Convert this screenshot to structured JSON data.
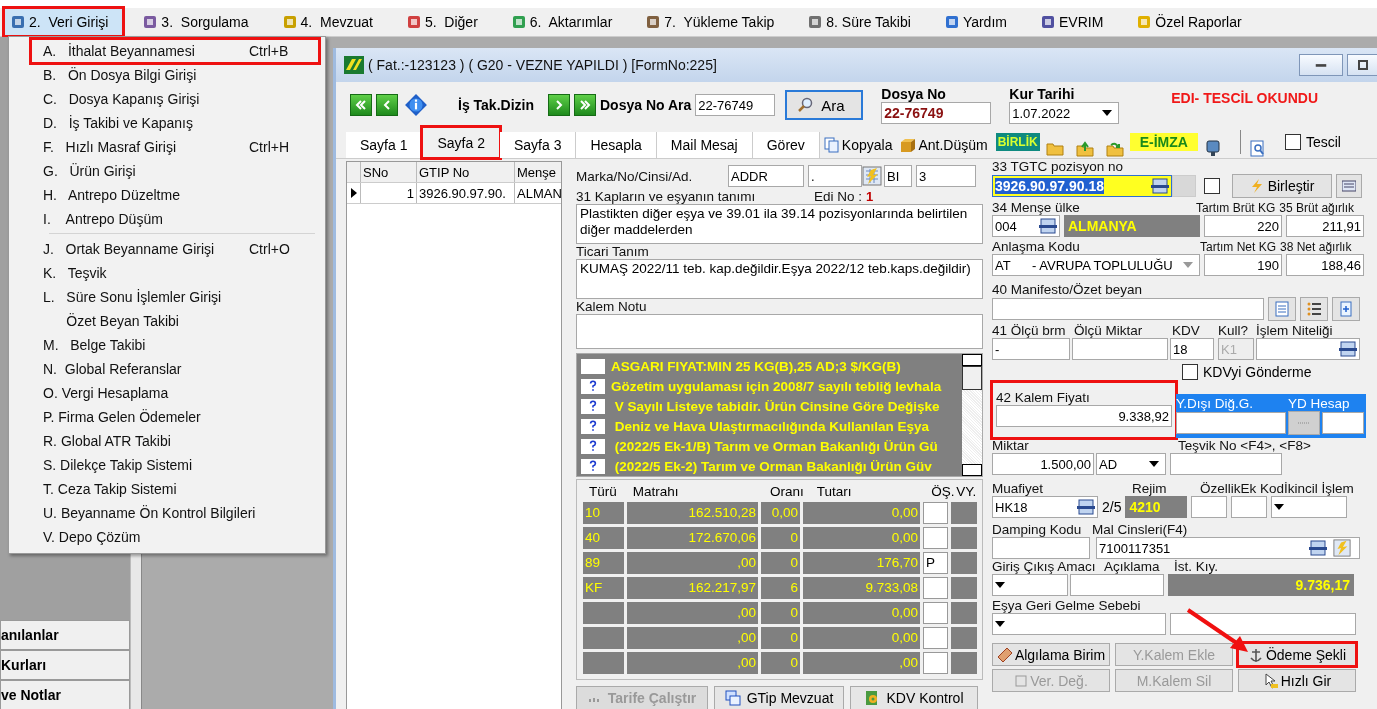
{
  "menu_bar": [
    {
      "label": "2.  Veri Girişi",
      "selected": true,
      "marked": true
    },
    {
      "label": "3.  Sorgulama",
      "selected": false,
      "marked": false
    },
    {
      "label": "4.  Mevzuat",
      "selected": false,
      "marked": false
    },
    {
      "label": "5.  Diğer",
      "selected": false,
      "marked": false
    },
    {
      "label": "6.  Aktarımlar",
      "selected": false,
      "marked": false
    },
    {
      "label": "7.  Yükleme Takip",
      "selected": false,
      "marked": false
    },
    {
      "label": "8. Süre Takibi",
      "selected": false,
      "marked": false
    },
    {
      "label": "Yardım",
      "selected": false,
      "marked": false
    },
    {
      "label": "EVRIM",
      "selected": false,
      "marked": false
    },
    {
      "label": "Özel Raporlar",
      "selected": false,
      "marked": false
    }
  ],
  "dropdown": {
    "groups": [
      [
        {
          "label": "A.   İthalat Beyannamesi",
          "shortcut": "Ctrl+B",
          "marked": true
        },
        {
          "label": "B.   Ön Dosya Bilgi Girişi",
          "marked": false
        },
        {
          "label": "C.   Dosya Kapanış Girişi",
          "marked": false
        },
        {
          "label": "D.   İş Takibi ve Kapanış",
          "marked": false
        },
        {
          "label": "F.   Hızlı Masraf Girişi",
          "shortcut": "Ctrl+H",
          "marked": false
        },
        {
          "label": "G.   Ürün Girişi",
          "marked": false
        },
        {
          "label": "H.   Antrepo Düzeltme",
          "marked": false
        },
        {
          "label": "I.    Antrepo Düşüm",
          "marked": false
        }
      ],
      [
        {
          "label": "J.   Ortak Beyanname Girişi",
          "shortcut": "Ctrl+O",
          "marked": false
        },
        {
          "label": "K.   Teşvik",
          "marked": false
        },
        {
          "label": "L.   Süre Sonu İşlemler Girişi",
          "marked": false
        },
        {
          "label": "      Özet Beyan Takibi",
          "marked": false
        },
        {
          "label": "M.   Belge Takibi",
          "marked": false
        },
        {
          "label": "N.  Global Referanslar",
          "marked": false
        },
        {
          "label": "O. Vergi Hesaplama",
          "marked": false
        },
        {
          "label": "P. Firma Gelen Ödemeler",
          "marked": false
        },
        {
          "label": "R. Global ATR Takibi",
          "marked": false
        },
        {
          "label": "S. Dilekçe Takip Sistemi",
          "marked": false
        },
        {
          "label": "T. Ceza Takip Sistemi",
          "marked": false
        },
        {
          "label": "U. Beyanname Ön Kontrol Bilgileri",
          "marked": false
        },
        {
          "label": "V. Depo Çözüm",
          "marked": false
        }
      ]
    ]
  },
  "sidebar": {
    "buttons": [
      "anılanlar",
      "Kurları",
      "ve Notlar"
    ]
  },
  "window": {
    "title": "( Fat.:-123123 ) ( G20 - VEZNE YAPILDI ) [FormNo:225]",
    "toolbar": {
      "dizin_label": "İş Tak.Dizin",
      "search_label": "Dosya No Ara",
      "search_value": "22-76749",
      "search_button": "Ara",
      "dosya_label": "Dosya No",
      "dosya_value": "22-76749",
      "kur_label": "Kur Tarihi",
      "kur_value": "1.07.2022",
      "status": "EDI- TESCİL OKUNDU"
    },
    "tabs": [
      {
        "label": "Sayfa 1",
        "selected": false,
        "marked": false
      },
      {
        "label": "Sayfa 2",
        "selected": true,
        "marked": true
      },
      {
        "label": "Sayfa 3",
        "selected": false,
        "marked": false
      },
      {
        "label": "Hesapla",
        "selected": false,
        "marked": false
      },
      {
        "label": "Mail Mesaj",
        "selected": false,
        "marked": false
      },
      {
        "label": "Görev",
        "selected": false,
        "marked": false
      }
    ],
    "actions": {
      "copy": "Kopyala",
      "ant": "Ant.Düşüm",
      "birlik": "BİRLİK",
      "eimza": "E-İMZA",
      "tescil": "Tescil",
      "tescil_checked": false
    },
    "grid": {
      "columns": [
        "SNo",
        "GTIP No",
        "Menşe"
      ],
      "rows": [
        [
          "1",
          "3926.90.97.90.",
          "ALMAN"
        ]
      ]
    },
    "middle": {
      "marka_label": "Marka/No/Cinsi/Ad.",
      "marka": [
        "ADDR",
        ".",
        "BI",
        "3"
      ],
      "tanim_label": "31 Kapların ve eşyanın tanımı",
      "edi_label": "Edi No :",
      "edi_value": "1",
      "tanim": "Plastikten diğer eşya ve 39.01 ila 39.14 pozisyonlarında belirtilen diğer maddelerden",
      "ticari_label": "Ticari Tanım",
      "ticari": "KUMAŞ 2022/11 teb. kap.değildir.Eşya 2022/12 teb.kaps.değildir)",
      "not_label": "Kalem Notu",
      "warnings": [
        {
          "text": "ASGARI FIYAT:MIN 25 KG(B),25 AD;3 $/KG(B)",
          "help": false
        },
        {
          "text": "Gözetim uygulaması için 2008/7 sayılı tebliğ levhala",
          "help": true
        },
        {
          "text": " V Sayılı Listeye tabidir. Ürün Cinsine Göre Değişke",
          "help": true
        },
        {
          "text": " Deniz ve Hava Ulaştırmacılığında Kullanılan Eşya",
          "help": true
        },
        {
          "text": " (2022/5 Ek-1/B) Tarım ve Orman Bakanlığı Ürün Gü",
          "help": true
        },
        {
          "text": " (2022/5 Ek-2) Tarım ve Orman Bakanlığı Ürün Güv",
          "help": true
        }
      ],
      "tax_columns": [
        "Türü",
        "Matrahı",
        "Oranı",
        "Tutarı",
        "ÖŞ.",
        "VY."
      ],
      "tax_rows": [
        {
          "type": "10",
          "base": "162.510,28",
          "rate": "0,00",
          "amount": "0,00"
        },
        {
          "type": "40",
          "base": "172.670,06",
          "rate": "0",
          "amount": "0,00"
        },
        {
          "type": "89",
          "base": ",00",
          "rate": "0",
          "amount": "176,70",
          "os": "P"
        },
        {
          "type": "KF",
          "base": "162.217,97",
          "rate": "6",
          "amount": "9.733,08"
        },
        {
          "base": ",00",
          "rate": "0",
          "amount": "0,00"
        },
        {
          "base": ",00",
          "rate": "0",
          "amount": "0,00"
        },
        {
          "base": ",00",
          "rate": "0",
          "amount": ",00"
        }
      ],
      "buttons": [
        {
          "label": "Tarife Çalıştır",
          "disabled": true
        },
        {
          "label": "GTip Mevzuat",
          "disabled": false
        },
        {
          "label": "KDV Kontrol",
          "disabled": false
        }
      ]
    },
    "right": {
      "gtip_label": "33 TGTC pozisyon no",
      "gtip": "3926.90.97.90.18",
      "birlestir": "Birleştir",
      "birlestir_checked": false,
      "mense_label": "34 Menşe ülke",
      "mense_code": "004",
      "mense_name": "ALMANYA",
      "brut_kg_label": "Tartım Brüt KG",
      "brut_kg": "220",
      "brut_label": "35 Brüt ağırlık",
      "brut": "211,91",
      "anlasma_label": "Anlaşma Kodu",
      "anlasma": "AT      - AVRUPA TOPLULUĞU",
      "net_kg_label": "Tartım Net KG",
      "net_kg": "190",
      "net_label": "38 Net ağırlık",
      "net": "188,46",
      "manifesto_label": "40 Manifesto/Özet beyan",
      "olcu_label": "41 Ölçü brm",
      "olcu": "-",
      "olcu_miktar_label": "Ölçü Miktar",
      "kdv_label": "KDV",
      "kdv": "18",
      "kull_label": "Kull?",
      "kull": "K1",
      "islem_label": "İşlem Niteliği",
      "kdv_gonderme": "KDVyi Gönderme",
      "kdv_gonderme_checked": false,
      "fiyat_label": "42 Kalem Fiyatı",
      "fiyat": "9.338,92",
      "fiyat_marked": true,
      "ydisi_label": "Y.Dışı Diğ.G.",
      "yd_label": "YD Hesap",
      "miktar_label": "Miktar",
      "miktar": "1.500,00",
      "birim": "AD",
      "tesvik_label": "Teşvik No <F4>, <F8>",
      "muafiyet_label": "Muafiyet",
      "muafiyet": "HK18",
      "muafiyet_count": "2/5",
      "rejim_label": "Rejim",
      "rejim": "4210",
      "ozellik_label": "Özellik",
      "ek_kod_label": "Ek Kod",
      "ikincil_label": "İkincil İşlem",
      "damping_label": "Damping Kodu",
      "mal_label": "Mal Cinsleri(F4)",
      "mal": "7100117351",
      "amac_label": "Giriş Çıkış Amacı",
      "aciklama_label": "Açıklama",
      "kiy_label": "İst. Kıy.",
      "kiy": "9.736,17",
      "geri_label": "Eşya Geri Gelme Sebebi",
      "callout_arrow": true,
      "buttons": [
        {
          "label": "Algılama Birim",
          "disabled": false,
          "marked": false
        },
        {
          "label": "Y.Kalem Ekle",
          "disabled": true,
          "marked": false
        },
        {
          "label": "Ödeme Şekli",
          "disabled": false,
          "marked": true
        },
        {
          "label": "Ver. Değ.",
          "disabled": true,
          "marked": false
        },
        {
          "label": "M.Kalem Sil",
          "disabled": true,
          "marked": false
        },
        {
          "label": "Hızlı Gir",
          "disabled": false,
          "marked": false
        }
      ]
    }
  }
}
